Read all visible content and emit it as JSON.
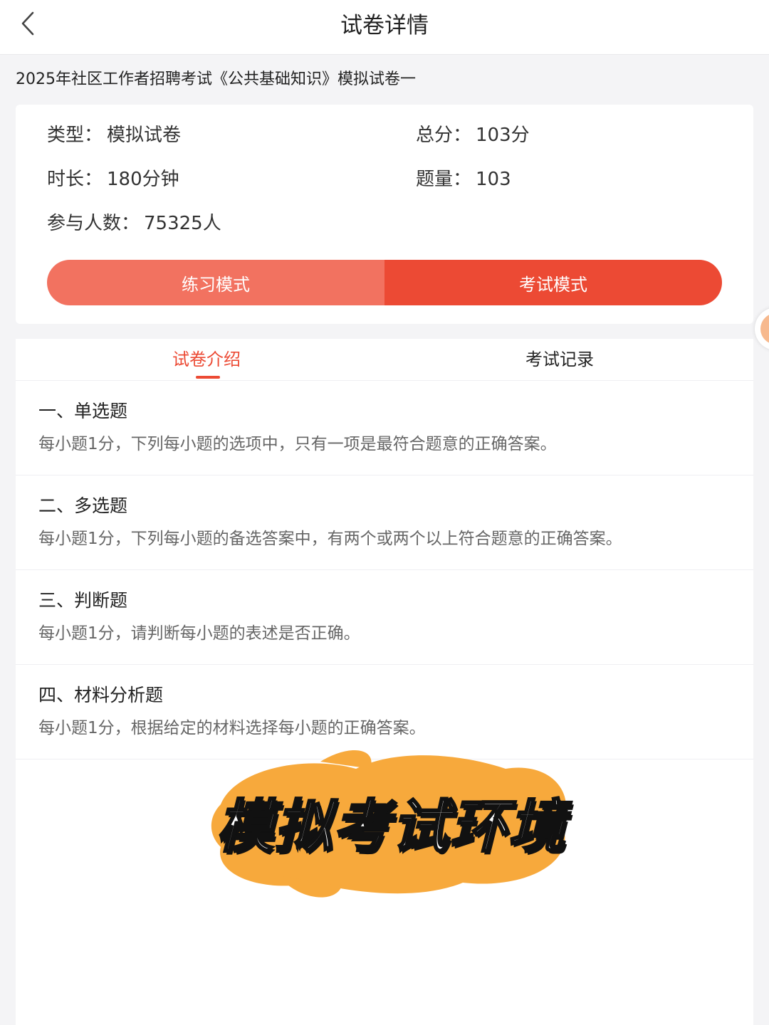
{
  "header": {
    "title": "试卷详情",
    "back_icon": "chevron-left-icon"
  },
  "paper": {
    "title": "2025年社区工作者招聘考试《公共基础知识》模拟试卷一"
  },
  "info": {
    "type_label": "类型：",
    "type_value": "模拟试卷",
    "score_label": "总分：",
    "score_value": "103分",
    "duration_label": "时长：",
    "duration_value": "180分钟",
    "count_label": "题量：",
    "count_value": "103",
    "participants_label": "参与人数：",
    "participants_value": "75325人"
  },
  "modes": {
    "practice_label": "练习模式",
    "exam_label": "考试模式"
  },
  "tabs": {
    "intro_label": "试卷介绍",
    "records_label": "考试记录",
    "active": "试卷介绍"
  },
  "sections": [
    {
      "title": "一、单选题",
      "desc": "每小题1分，下列每小题的选项中，只有一项是最符合题意的正确答案。"
    },
    {
      "title": "二、多选题",
      "desc": "每小题1分，下列每小题的备选答案中，有两个或两个以上符合题意的正确答案。"
    },
    {
      "title": "三、判断题",
      "desc": "每小题1分，请判断每小题的表述是否正确。"
    },
    {
      "title": "四、材料分析题",
      "desc": "每小题1分，根据给定的材料选择每小题的正确答案。"
    }
  ],
  "overlay": {
    "caption": "模拟考试环境"
  },
  "colors": {
    "accent": "#ec4a34",
    "practice": "#f27260",
    "highlight": "#f7a93c"
  }
}
